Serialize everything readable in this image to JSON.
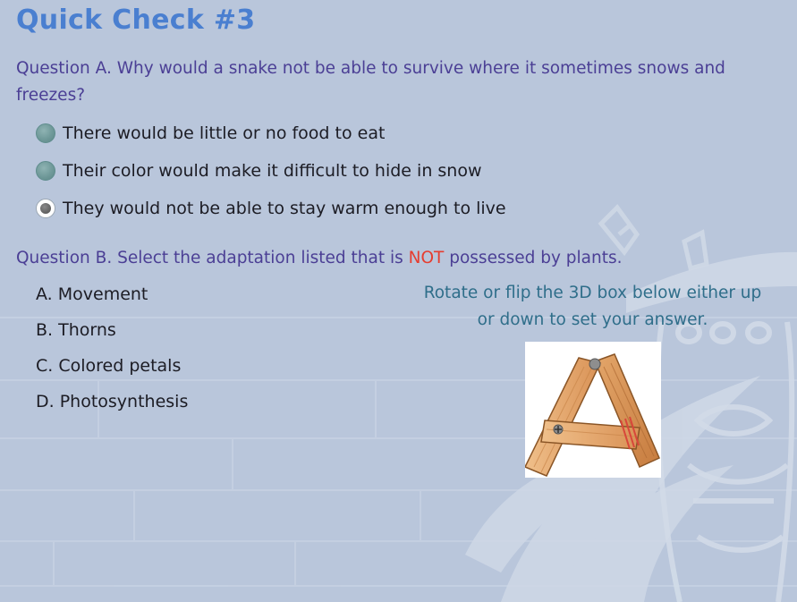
{
  "title": "Quick Check #3",
  "question_a": {
    "text": "Question A. Why would a snake not be able to survive where it sometimes snows and freezes?",
    "options": [
      {
        "label": "There would be little or no food to eat",
        "selected": false
      },
      {
        "label": "Their color would make it difficult to hide in snow",
        "selected": false
      },
      {
        "label": "They would not be able to stay warm enough to live",
        "selected": true
      }
    ]
  },
  "question_b": {
    "text_before": "Question B. Select the adaptation listed that is ",
    "emphasis": "NOT",
    "text_after": " possessed by plants.",
    "choices": [
      "A. Movement",
      "B. Thorns",
      "C. Colored petals",
      "D. Photosynthesis"
    ]
  },
  "instruction": "Rotate or flip the 3D box below either up or down to set your answer.",
  "box_3d": {
    "face_letter_icon": "wooden-letter-a-icon"
  },
  "colors": {
    "title": "#4a7fd0",
    "question": "#4b3f95",
    "emphasis": "#e63d30",
    "instruction": "#2f6e8a",
    "background": "#b9c6db"
  }
}
